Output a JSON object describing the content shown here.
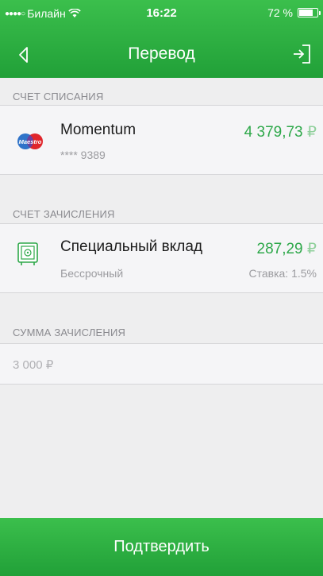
{
  "status_bar": {
    "carrier": "Билайн",
    "time": "16:22",
    "battery_text": "72 %",
    "battery_level": 0.72
  },
  "nav": {
    "title": "Перевод"
  },
  "debit_account": {
    "section_label": "СЧЕТ СПИСАНИЯ",
    "card_brand": "Maestro",
    "name": "Momentum",
    "number": "**** 9389",
    "amount": "4 379,73",
    "currency": "₽"
  },
  "credit_account": {
    "section_label": "СЧЕТ ЗАЧИСЛЕНИЯ",
    "name": "Специальный вклад",
    "term": "Бессрочный",
    "amount": "287,29",
    "currency": "₽",
    "rate": "Ставка: 1.5%"
  },
  "amount": {
    "section_label": "СУММА ЗАЧИСЛЕНИЯ",
    "placeholder": "3 000 ₽",
    "value": ""
  },
  "confirm_label": "Подтвердить",
  "colors": {
    "brand_green": "#21a038",
    "amount_green": "#2ea84a"
  }
}
